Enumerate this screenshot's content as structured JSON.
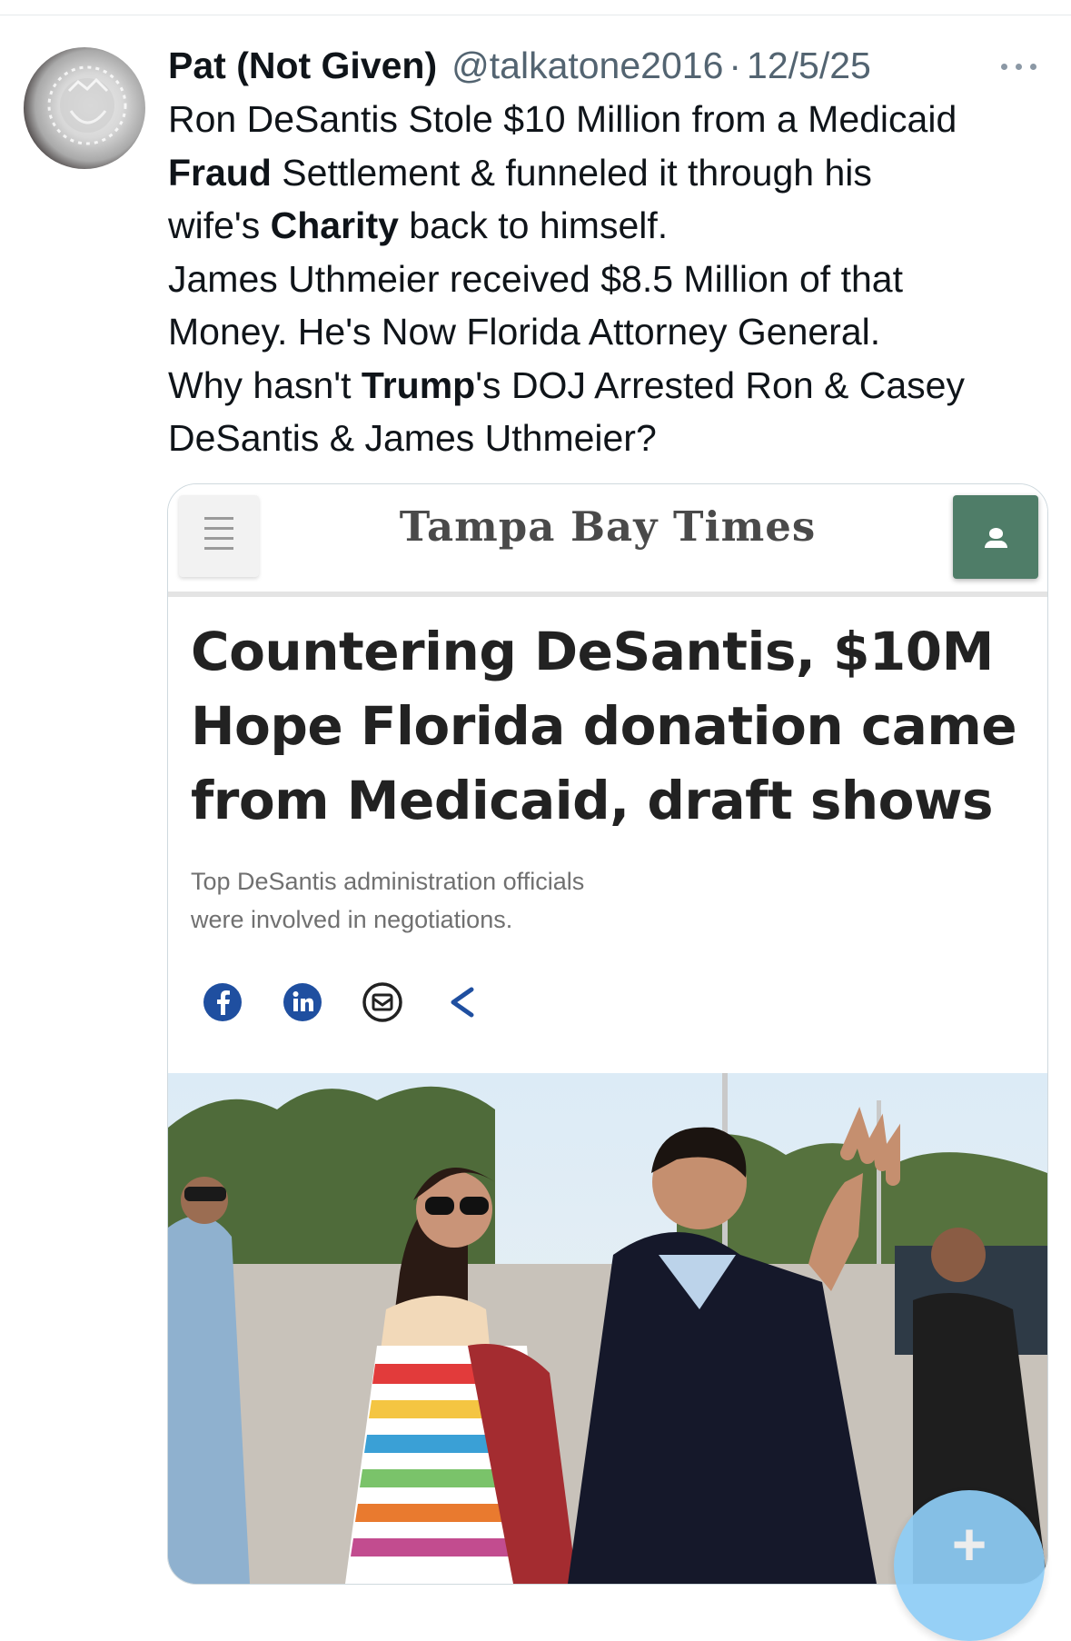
{
  "tweet": {
    "author_name": "Pat (Not Given)",
    "handle": "@talkatone2016",
    "separator": "·",
    "date": "12/5/25",
    "more_icon": "more-horizontal-icon",
    "avatar_icon": "profile-avatar",
    "text": {
      "l1": "Ron DeSantis Stole $10 Million from a Medicaid",
      "l2_bold": "Fraud",
      "l2_rest": " Settlement & funneled it through his",
      "l3_pre": "wife's ",
      "l3_bold": "Charity",
      "l3_rest": " back to himself.",
      "l4": "James Uthmeier received $8.5 Million of that",
      "l5": "Money. He's Now Florida Attorney General.",
      "l6_pre": "Why hasn't ",
      "l6_bold": "Trump",
      "l6_rest": "'s DOJ Arrested Ron & Casey",
      "l7": "DeSantis & James Uthmeier?"
    }
  },
  "media": {
    "masthead": "Tampa Bay Times",
    "menu_icon": "hamburger-menu-icon",
    "account_icon": "account-person-icon",
    "headline": {
      "l1": "Countering DeSantis, $10M",
      "l2": "Hope Florida donation came",
      "l3": "from Medicaid, draft shows"
    },
    "subhead": {
      "l1": "Top DeSantis administration officials",
      "l2": "were involved in negotiations."
    },
    "share_icons": [
      "facebook-icon",
      "linkedin-icon",
      "email-icon",
      "share-icon"
    ],
    "colors": {
      "social_blue": "#1f4fa0",
      "account_green": "#4f7d68"
    }
  },
  "compose_button": {
    "label": "+",
    "color": "#8ecdf6"
  }
}
